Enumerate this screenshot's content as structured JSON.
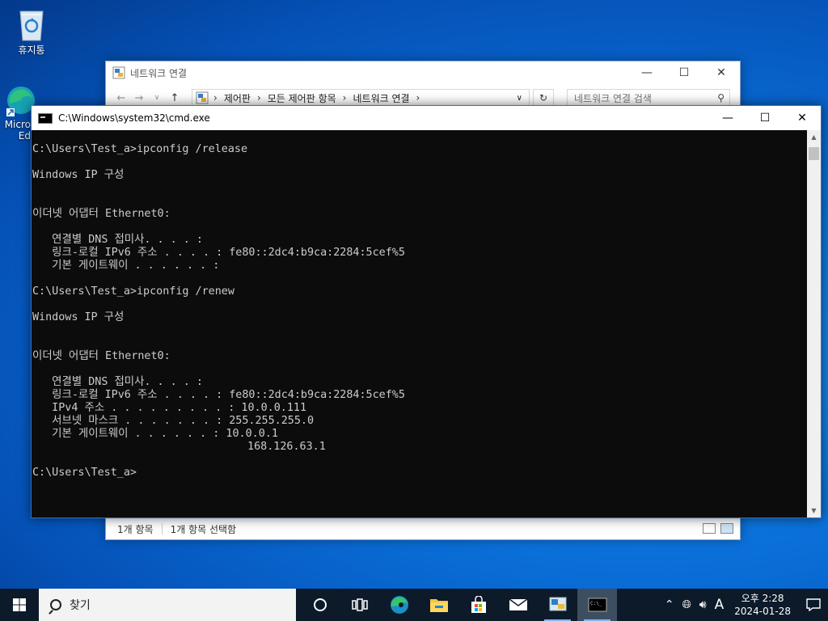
{
  "desktop": {
    "icons": [
      {
        "label": "휴지통",
        "icon": "recycle-bin-icon"
      },
      {
        "label": "Micro Ed",
        "icon": "edge-shortcut-icon"
      }
    ]
  },
  "explorer": {
    "title": "네트워크 연결",
    "breadcrumb": [
      "제어판",
      "모든 제어판 항목",
      "네트워크 연결"
    ],
    "search_placeholder": "네트워크 연결 검색",
    "status_count": "1개 항목",
    "status_selected": "1개 항목 선택함"
  },
  "cmd": {
    "title": "C:\\Windows\\system32\\cmd.exe",
    "lines": [
      "C:\\Users\\Test_a>ipconfig /release",
      "",
      "Windows IP 구성",
      "",
      "",
      "이더넷 어댑터 Ethernet0:",
      "",
      "   연결별 DNS 접미사. . . . :",
      "   링크-로컬 IPv6 주소 . . . . : fe80::2dc4:b9ca:2284:5cef%5",
      "   기본 게이트웨이 . . . . . . :",
      "",
      "C:\\Users\\Test_a>ipconfig /renew",
      "",
      "Windows IP 구성",
      "",
      "",
      "이더넷 어댑터 Ethernet0:",
      "",
      "   연결별 DNS 접미사. . . . :",
      "   링크-로컬 IPv6 주소 . . . . : fe80::2dc4:b9ca:2284:5cef%5",
      "   IPv4 주소 . . . . . . . . . : 10.0.0.111",
      "   서브넷 마스크 . . . . . . . : 255.255.255.0",
      "   기본 게이트웨이 . . . . . . : 10.0.0.1",
      "                                 168.126.63.1",
      "",
      "C:\\Users\\Test_a>"
    ]
  },
  "taskbar": {
    "search_text": "찾기",
    "apps": [
      {
        "name": "cortana",
        "icon": "cortana-circle-icon"
      },
      {
        "name": "task-view",
        "icon": "task-view-icon"
      },
      {
        "name": "edge",
        "icon": "edge-icon"
      },
      {
        "name": "file-explorer",
        "icon": "folder-icon"
      },
      {
        "name": "store",
        "icon": "store-bag-icon"
      },
      {
        "name": "mail",
        "icon": "mail-icon"
      },
      {
        "name": "network-connections",
        "icon": "network-connections-icon"
      },
      {
        "name": "cmd",
        "icon": "cmd-icon"
      }
    ],
    "tray": {
      "ime": "A",
      "time": "오후 2:28",
      "date": "2024-01-28"
    }
  },
  "colors": {
    "cmd_bg": "#0c0c0c",
    "cmd_fg": "#cccccc",
    "taskbar_bg": "#0c1a2a",
    "desktop_accent": "#0a6fd8"
  }
}
